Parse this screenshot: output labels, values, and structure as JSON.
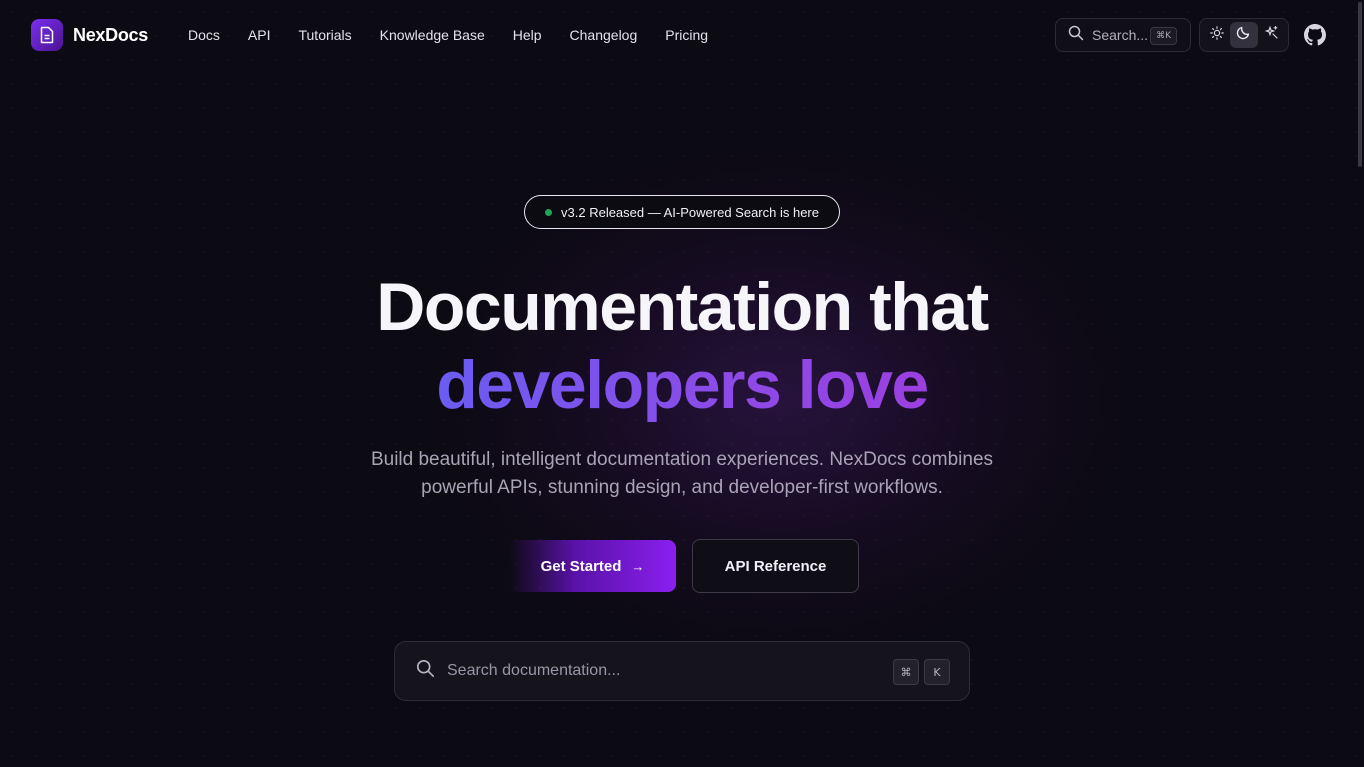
{
  "brand": {
    "name": "NexDocs"
  },
  "nav": {
    "items": [
      {
        "label": "Docs"
      },
      {
        "label": "API"
      },
      {
        "label": "Tutorials"
      },
      {
        "label": "Knowledge Base"
      },
      {
        "label": "Help"
      },
      {
        "label": "Changelog"
      },
      {
        "label": "Pricing"
      }
    ]
  },
  "header_search": {
    "label": "Search...",
    "shortcut": "⌘K"
  },
  "theme": {
    "options": [
      "light",
      "dark",
      "system"
    ],
    "selected": "dark"
  },
  "announcement": {
    "text": "v3.2 Released — AI-Powered Search is here",
    "status_color": "#22a45a"
  },
  "hero": {
    "title_line1": "Documentation that",
    "title_line2": "developers love",
    "subtitle": "Build beautiful, intelligent documentation experiences. NexDocs combines powerful APIs, stunning design, and developer-first workflows."
  },
  "cta": {
    "primary_label": "Get Started",
    "primary_icon": "→",
    "secondary_label": "API Reference"
  },
  "doc_search": {
    "placeholder": "Search documentation...",
    "key1": "⌘",
    "key2": "K"
  },
  "colors": {
    "background": "#0c0a12",
    "accent": "#8b1ff0",
    "gradient_start": "#6b5cf2",
    "gradient_end": "#9b3fe0"
  }
}
